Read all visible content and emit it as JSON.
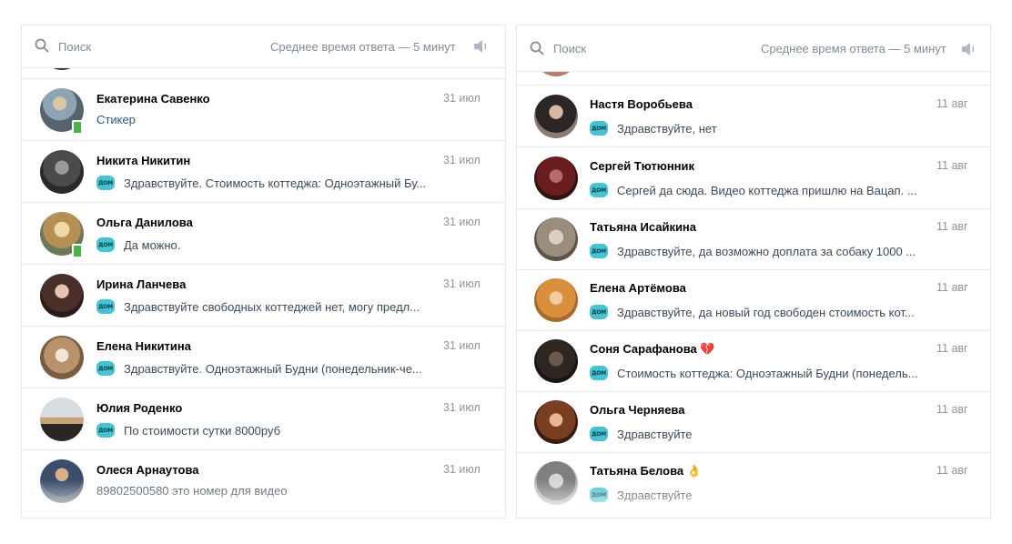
{
  "colors": {
    "accent": "#2a5885",
    "muted": "#818c99",
    "online": "#4bb34b",
    "bot_badge": "#46c3d2"
  },
  "left_panel": {
    "search_placeholder": "Поиск",
    "response_time": "Среднее время ответа — 5 минут",
    "sound_icon": "speaker-icon",
    "dialogs": [
      {
        "name": "Екатерина Савенко",
        "date": "31 июл",
        "message": "Стикер",
        "online": true,
        "badge": false
      },
      {
        "name": "Никита Никитин",
        "date": "31 июл",
        "message": "Здравствуйте. Стоимость коттеджа: Одноэтажный Бу...",
        "online": false,
        "badge": true
      },
      {
        "name": "Ольга Данилова",
        "date": "31 июл",
        "message": "Да можно.",
        "online": true,
        "badge": true
      },
      {
        "name": "Ирина Ланчева",
        "date": "31 июл",
        "message": "Здравствуйте свободных коттеджей нет, могу предл...",
        "online": false,
        "badge": true
      },
      {
        "name": "Елена Никитина",
        "date": "31 июл",
        "message": "Здравствуйте. Одноэтажный Будни (понедельник-че...",
        "online": false,
        "badge": true
      },
      {
        "name": "Юлия Роденко",
        "date": "31 июл",
        "message": "По стоимости сутки 8000руб",
        "online": false,
        "badge": true
      },
      {
        "name": "Олеся Арнаутова",
        "date": "31 июл",
        "message": "89802500580 это номер для видео",
        "online": false,
        "badge": false
      }
    ]
  },
  "right_panel": {
    "search_placeholder": "Поиск",
    "response_time": "Среднее время ответа — 5 минут",
    "sound_icon": "speaker-icon",
    "dialogs": [
      {
        "name": "Настя Воробьева",
        "date": "11 авг",
        "message": "Здравствуйте, нет",
        "online": false,
        "badge": true
      },
      {
        "name": "Сергей Тютюнник",
        "date": "11 авг",
        "message": "Сергей да сюда. Видео коттеджа пришлю на Вацап. ...",
        "online": false,
        "badge": true
      },
      {
        "name": "Татьяна Исайкина",
        "date": "11 авг",
        "message": "Здравствуйте, да возможно доплата за собаку 1000 ...",
        "online": false,
        "badge": true
      },
      {
        "name": "Елена Артёмова",
        "date": "11 авг",
        "message": "Здравствуйте, да новый год свободен стоимость кот...",
        "online": false,
        "badge": true
      },
      {
        "name": "Соня Сарафанова",
        "name_emoji": "💔",
        "date": "11 авг",
        "message": "Стоимость коттеджа: Одноэтажный Будни (понедель...",
        "online": false,
        "badge": true
      },
      {
        "name": "Ольга Черняева",
        "date": "11 авг",
        "message": "Здравствуйте",
        "online": false,
        "badge": true
      },
      {
        "name": "Татьяна Белова",
        "name_emoji": "👌",
        "date": "11 авг",
        "message": "Здравствуйте",
        "online": false,
        "badge": true
      }
    ]
  }
}
